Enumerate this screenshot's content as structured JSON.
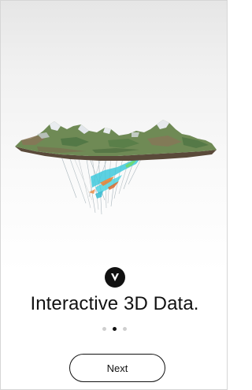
{
  "onboarding": {
    "title": "Interactive 3D Data.",
    "hero_image": "3d-terrain-drillhole-visualization",
    "logo_icon": "v-logo-icon",
    "page_indicator": {
      "total": 3,
      "active_index": 2
    },
    "next_label": "Next"
  },
  "colors": {
    "background_top": "#e6e6e6",
    "background_bottom": "#ffffff",
    "text": "#111111",
    "dot_inactive": "#cfcfcf",
    "dot_active": "#111111",
    "terrain_green": "#5f7f4a",
    "terrain_brown": "#8b6a48",
    "drill_cyan": "#3fc9dc",
    "drill_orange": "#e8843a"
  }
}
